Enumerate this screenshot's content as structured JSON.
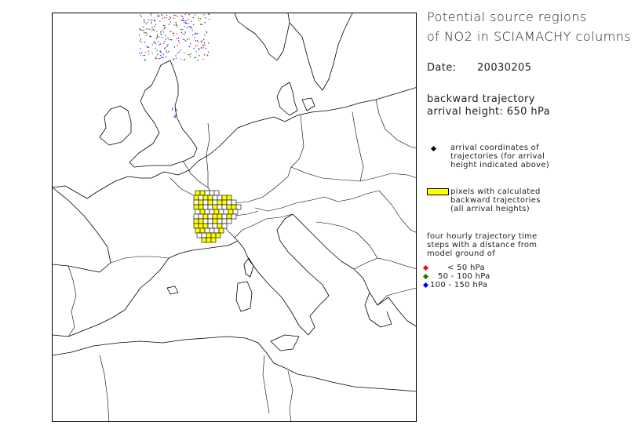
{
  "title_line1": "Potential source regions",
  "title_line2": "of NO2 in SCIAMACHY columns",
  "date_label": "Date:",
  "date_value": "20030205",
  "trajectory_line1": "backward trajectory",
  "trajectory_line2": "arrival height: 650 hPa",
  "legend": {
    "arrival": {
      "lines": [
        "arrival coordinates of",
        "trajectories (for arrival",
        "height indicated above)"
      ],
      "color": "#000000"
    },
    "pixels": {
      "lines": [
        "pixels with calculated",
        "backward trajectories",
        "(all arrival heights)"
      ],
      "color": "#ffff00"
    },
    "steps_lines": [
      "four hourly trajectory time",
      "steps with a distance from",
      "model ground of"
    ],
    "bands": [
      {
        "label": "< 50 hPa",
        "color": "#ff0000"
      },
      {
        "label": "50 - 100 hPa",
        "color": "#008000"
      },
      {
        "label": "100 - 150 hPa",
        "color": "#0000ff"
      }
    ]
  }
}
